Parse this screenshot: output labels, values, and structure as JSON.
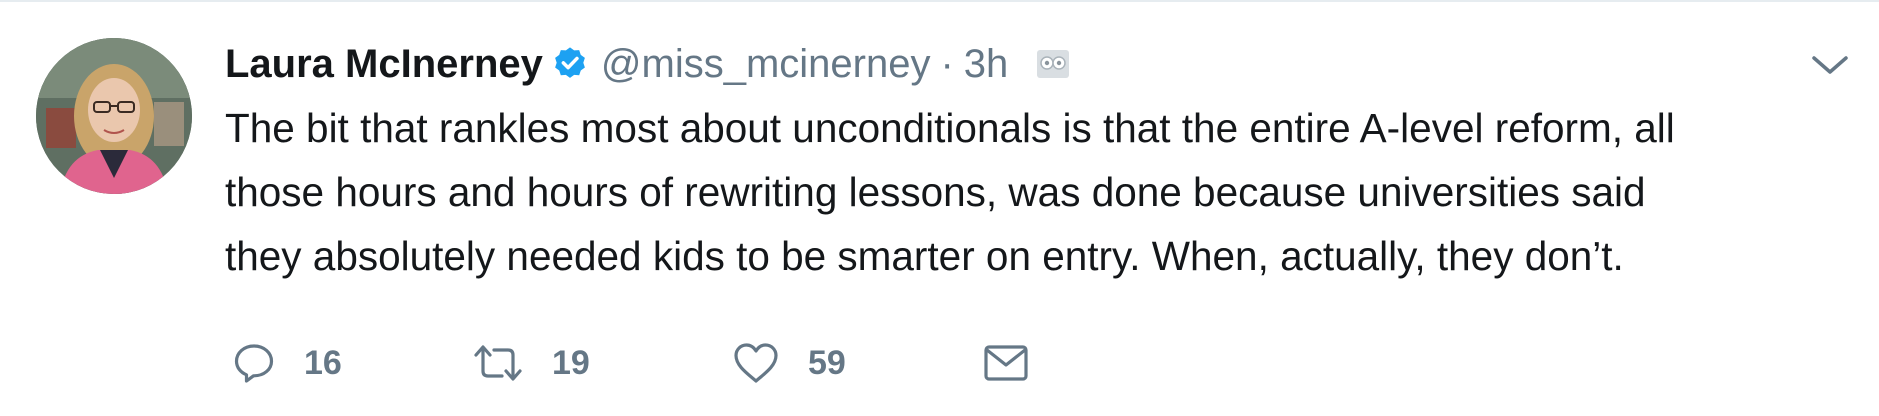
{
  "tweet": {
    "display_name": "Laura McInerney",
    "handle": "@miss_mcinerney",
    "separator": "·",
    "timestamp": "3h",
    "text_lines": [
      "The bit that rankles most about unconditionals is that the entire A-level reform, all",
      "those hours and hours of rewriting lessons, was done because universities said",
      "they absolutely needed kids to be smarter on entry. When, actually, they don’t."
    ],
    "verified": true,
    "icons": {
      "verified": "verified-badge-icon",
      "app": "hootsuite-owl-icon",
      "caret": "chevron-down-icon",
      "reply": "reply-icon",
      "retweet": "retweet-icon",
      "like": "heart-icon",
      "dm": "envelope-icon"
    }
  },
  "actions": {
    "reply_count": "16",
    "retweet_count": "19",
    "like_count": "59"
  },
  "colors": {
    "text": "#14171a",
    "secondary": "#657786",
    "verified": "#1da1f2",
    "border": "#e6ecf0"
  }
}
